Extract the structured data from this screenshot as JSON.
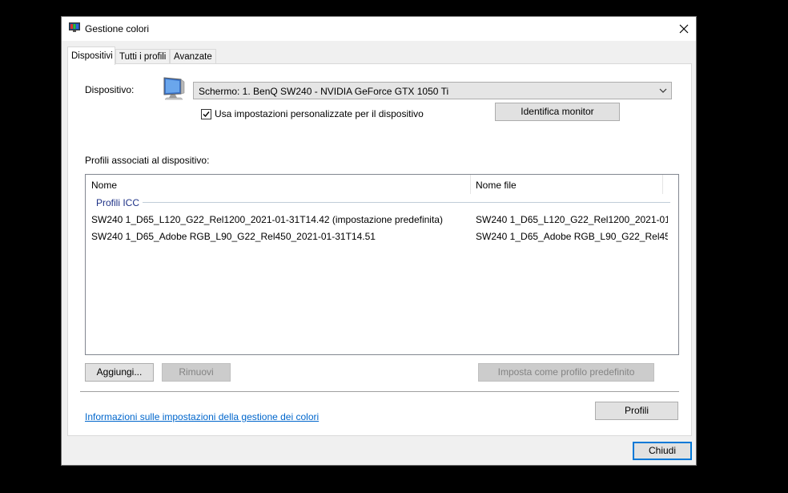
{
  "window": {
    "title": "Gestione colori",
    "close_glyph": "✕"
  },
  "tabs": [
    {
      "label": "Dispositivi",
      "active": true
    },
    {
      "label": "Tutti i profili",
      "active": false
    },
    {
      "label": "Avanzate",
      "active": false
    }
  ],
  "device": {
    "label": "Dispositivo:",
    "selected": "Schermo: 1. BenQ SW240 - NVIDIA GeForce GTX 1050 Ti",
    "icon": "monitor-icon",
    "custom_settings_label": "Usa impostazioni personalizzate per il dispositivo",
    "custom_settings_checked": true,
    "identify_button": "Identifica monitor"
  },
  "profiles": {
    "section_label": "Profili associati al dispositivo:",
    "columns": [
      "Nome",
      "Nome file"
    ],
    "group": "Profili ICC",
    "rows": [
      {
        "name": "SW240 1_D65_L120_G22_Rel1200_2021-01-31T14.42 (impostazione predefinita)",
        "file": "SW240 1_D65_L120_G22_Rel1200_2021-01-..."
      },
      {
        "name": "SW240 1_D65_Adobe RGB_L90_G22_Rel450_2021-01-31T14.51",
        "file": "SW240 1_D65_Adobe RGB_L90_G22_Rel45..."
      }
    ]
  },
  "buttons": {
    "add": "Aggiungi...",
    "remove": "Rimuovi",
    "set_default": "Imposta come profilo predefinito",
    "profiles": "Profili",
    "close": "Chiudi"
  },
  "info_link": "Informazioni sulle impostazioni della gestione dei colori",
  "colors": {
    "accent": "#0078d7",
    "link": "#0066cc",
    "group_text": "#1e3287"
  }
}
